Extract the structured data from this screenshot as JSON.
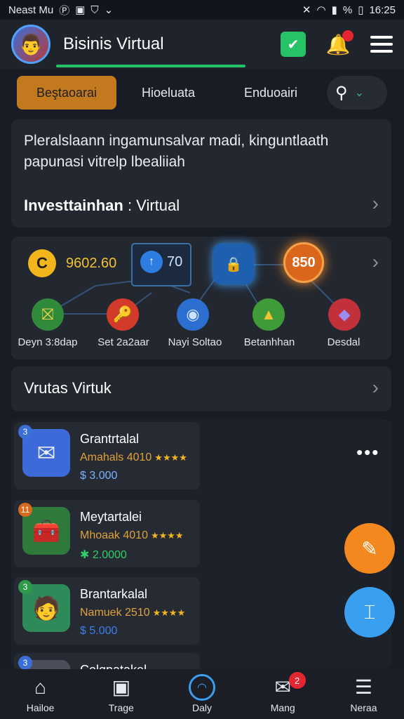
{
  "status": {
    "left_text": "Neast Mu",
    "time": "16:25",
    "battery": "%",
    "icons": [
      "circle-p-icon",
      "square-icon",
      "shield-icon",
      "chevron-icon",
      "mute-icon",
      "wifi-icon",
      "signal-icon",
      "battery-icon"
    ]
  },
  "appbar": {
    "title": "Bisinis Virtual",
    "avatar_glyph": "👨",
    "shield_glyph": "✔",
    "bell_glyph": "🔔"
  },
  "tabs": [
    {
      "label": "Beştaoarai"
    },
    {
      "label": "Hioeluata"
    },
    {
      "label": "Enduoairi"
    }
  ],
  "info": {
    "description": "Pleralslaann ingamunsalvar madi, kinguntlaath papunasi vitrelp lbealiiah",
    "subtitle_bold": "Investtainhan",
    "subtitle_rest": ": Virtual"
  },
  "graph": {
    "stat1": {
      "icon": "C",
      "value": "9602.60"
    },
    "stat2": {
      "icon": "↑",
      "value": "70"
    },
    "badge_value": "850",
    "nodes": [
      {
        "label": "Deyn 3:8dap",
        "glyph": "⛝",
        "color": "#2f8a3a"
      },
      {
        "label": "Set 2a2aar",
        "glyph": "🔑",
        "color": "#d23a2a"
      },
      {
        "label": "Nayi Soltao",
        "glyph": "◉",
        "color": "#2d6fd0"
      },
      {
        "label": "Betanhhan",
        "glyph": "▲",
        "color": "#3f9b3a"
      },
      {
        "label": "Desdal",
        "glyph": "◆",
        "color": "#c2303a"
      }
    ]
  },
  "section": {
    "title": "Vrutas Virtuk"
  },
  "items": [
    {
      "name": "Grantrtalal",
      "meta": "Amahals",
      "rating": "4010",
      "stars": "★★★★",
      "price": "$ 3.000",
      "price_color": "#7fb0ff",
      "thumb_glyph": "✉",
      "thumb_bg": "#3d6ad9",
      "badge": "3",
      "badge_color": "#3b6fd8"
    },
    {
      "name": "Meytartalei",
      "meta": "Mhoaak",
      "rating": "4010",
      "stars": "★★★★",
      "price": "✱ 2.0000",
      "price_color": "#2fcf6a",
      "thumb_glyph": "🧰",
      "thumb_bg": "#2f7a3a",
      "badge": "11",
      "badge_color": "#d86a1e"
    },
    {
      "name": "Brantarkalal",
      "meta": "Namuek",
      "rating": "2510",
      "stars": "★★★★",
      "price": "$ 5.000",
      "price_color": "#3f7fe8",
      "thumb_glyph": "🧑",
      "thumb_bg": "#2f8a5a",
      "badge": "3",
      "badge_color": "#2f9a4a"
    },
    {
      "name": "Colqpatakel",
      "meta": "",
      "rating": "",
      "stars": "",
      "price": "",
      "price_color": "#ffffff",
      "thumb_glyph": "📁",
      "thumb_bg": "#4a4f5a",
      "badge": "3",
      "badge_color": "#3b6fd8"
    }
  ],
  "fabs": {
    "orange_glyph": "✎",
    "blue_glyph": "⌶"
  },
  "bottom_nav": [
    {
      "label": "Hailoe",
      "glyph": "⌂"
    },
    {
      "label": "Trage",
      "glyph": "▣"
    },
    {
      "label": "Daly",
      "glyph": "◠"
    },
    {
      "label": "Mang",
      "glyph": "✉",
      "count": "2"
    },
    {
      "label": "Neraa",
      "glyph": "☰"
    }
  ]
}
